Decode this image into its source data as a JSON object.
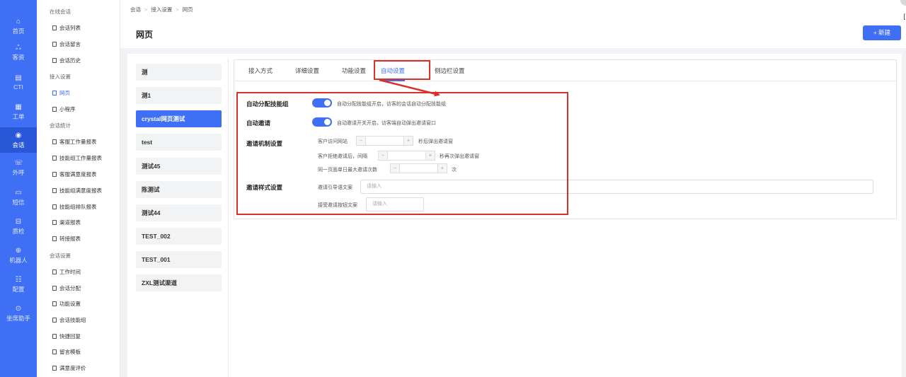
{
  "nav": {
    "items": [
      {
        "label": "首页",
        "icon": "home-icon"
      },
      {
        "label": "客资",
        "icon": "customers-icon"
      },
      {
        "label": "CTI",
        "icon": "cti-icon"
      },
      {
        "label": "工单",
        "icon": "ticket-icon"
      },
      {
        "label": "会话",
        "icon": "chat-icon"
      },
      {
        "label": "外呼",
        "icon": "phone-icon"
      },
      {
        "label": "短信",
        "icon": "sms-icon"
      },
      {
        "label": "质检",
        "icon": "quality-icon"
      },
      {
        "label": "机器人",
        "icon": "robot-icon"
      },
      {
        "label": "配置",
        "icon": "config-icon"
      },
      {
        "label": "坐席助手",
        "icon": "assistant-icon"
      }
    ]
  },
  "subnav": {
    "groups": {
      "online": "在线会话",
      "access": "接入设置",
      "stats": "会话统计",
      "session_settings": "会话设置"
    },
    "items": {
      "session_list": "会话列表",
      "session_messages": "会话留言",
      "session_history": "会话历史",
      "webpage": "网页",
      "mini_program": "小程序",
      "agent_workload": "客服工作量报表",
      "skill_workload": "技能组工作量报表",
      "agent_satisfaction": "客服满意度报表",
      "skill_satisfaction": "技能组满意度报表",
      "skill_queue": "技能组排队报表",
      "channel_report": "渠道报表",
      "transfer_report": "转接报表",
      "work_hours": "工作时间",
      "session_assign": "会话分配",
      "feature_settings": "功能设置",
      "session_skill_group": "会话技能组",
      "quick_reply": "快捷回复",
      "message_template": "留言模板",
      "satisfaction_eval": "满意度评价"
    }
  },
  "header": {
    "breadcrumb": [
      "会话",
      "接入设置",
      "网页"
    ],
    "title": "网页",
    "new_button": "+ 新建",
    "corner_char": "["
  },
  "channels": [
    "测",
    "测1",
    "crystal网页测试",
    "test",
    "测试45",
    "陈测试",
    "测试44",
    "TEST_002",
    "TEST_001",
    "ZXL测试渠道"
  ],
  "tabs": [
    "接入方式",
    "详细设置",
    "功能设置",
    "自动设置",
    "侧边栏设置"
  ],
  "auto_settings": {
    "auto_assign": {
      "label": "自动分配技能组",
      "enabled": true,
      "hint": "自动分配技能组开启，访客的会话自动分配技能组"
    },
    "auto_invite": {
      "label": "自动邀请",
      "enabled": true,
      "hint": "自动邀请开关开启，访客端自动弹出邀请窗口"
    },
    "invite_mechanism": {
      "label": "邀请机制设置",
      "row1_prefix": "客户访问网站",
      "row1_suffix": "秒后弹出邀请窗",
      "row2_prefix": "客户拒绝邀请后，间隔",
      "row2_suffix": "秒再次弹出邀请窗",
      "row3_prefix": "同一页面单日最大邀请次数",
      "row3_suffix": "次",
      "minus": "−",
      "plus": "+"
    },
    "invite_style": {
      "label": "邀请样式设置",
      "guide_text_label": "邀请引导语文案",
      "guide_text_placeholder": "请输入",
      "accept_btn_label": "接受邀请按钮文案",
      "accept_btn_placeholder": "请输入"
    }
  },
  "colors": {
    "primary": "#3e6ff5",
    "annotation": "#d9302a"
  }
}
